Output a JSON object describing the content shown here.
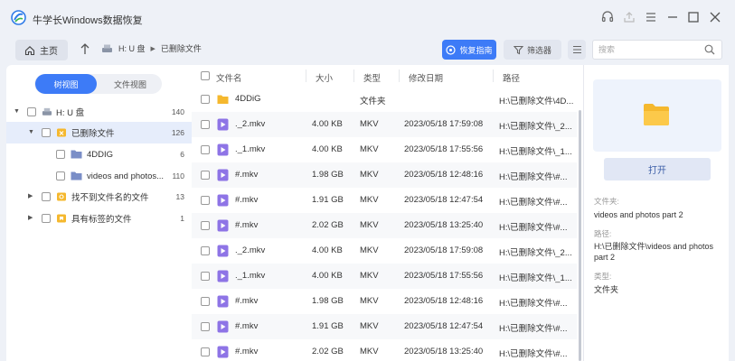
{
  "app": {
    "title": "牛学长Windows数据恢复"
  },
  "toolbar": {
    "home_label": "主页",
    "path": {
      "drive": "H: U 盘",
      "folder": "已删除文件"
    },
    "guide_label": "恢复指南",
    "filter_label": "筛选器",
    "search_placeholder": "搜索"
  },
  "left": {
    "tabs": {
      "tree": "树视图",
      "file": "文件视图"
    },
    "tree": [
      {
        "label": "H: U 盘",
        "count": "140"
      },
      {
        "label": "已删除文件",
        "count": "126"
      },
      {
        "label": "4DDIG",
        "count": "6"
      },
      {
        "label": "videos and photos...",
        "count": "110"
      },
      {
        "label": "找不到文件名的文件",
        "count": "13"
      },
      {
        "label": "具有标签的文件",
        "count": "1"
      }
    ]
  },
  "table": {
    "headers": {
      "name": "文件名",
      "size": "大小",
      "type": "类型",
      "date": "修改日期",
      "path": "路径"
    },
    "rows": [
      {
        "name": "4DDiG",
        "size": "",
        "type": "文件夹",
        "date": "",
        "path": "H:\\已删除文件\\4D..."
      },
      {
        "name": "._2.mkv",
        "size": "4.00 KB",
        "type": "MKV",
        "date": "2023/05/18 17:59:08",
        "path": "H:\\已删除文件\\_2..."
      },
      {
        "name": "._1.mkv",
        "size": "4.00 KB",
        "type": "MKV",
        "date": "2023/05/18 17:55:56",
        "path": "H:\\已删除文件\\_1..."
      },
      {
        "name": "#.mkv",
        "size": "1.98 GB",
        "type": "MKV",
        "date": "2023/05/18 12:48:16",
        "path": "H:\\已删除文件\\#..."
      },
      {
        "name": "#.mkv",
        "size": "1.91 GB",
        "type": "MKV",
        "date": "2023/05/18 12:47:54",
        "path": "H:\\已删除文件\\#..."
      },
      {
        "name": "#.mkv",
        "size": "2.02 GB",
        "type": "MKV",
        "date": "2023/05/18 13:25:40",
        "path": "H:\\已删除文件\\#..."
      },
      {
        "name": "._2.mkv",
        "size": "4.00 KB",
        "type": "MKV",
        "date": "2023/05/18 17:59:08",
        "path": "H:\\已删除文件\\_2..."
      },
      {
        "name": "._1.mkv",
        "size": "4.00 KB",
        "type": "MKV",
        "date": "2023/05/18 17:55:56",
        "path": "H:\\已删除文件\\_1..."
      },
      {
        "name": "#.mkv",
        "size": "1.98 GB",
        "type": "MKV",
        "date": "2023/05/18 12:48:16",
        "path": "H:\\已删除文件\\#..."
      },
      {
        "name": "#.mkv",
        "size": "1.91 GB",
        "type": "MKV",
        "date": "2023/05/18 12:47:54",
        "path": "H:\\已删除文件\\#..."
      },
      {
        "name": "#.mkv",
        "size": "2.02 GB",
        "type": "MKV",
        "date": "2023/05/18 13:25:40",
        "path": "H:\\已删除文件\\#..."
      }
    ]
  },
  "details": {
    "open_label": "打开",
    "folder_label": "文件夹:",
    "folder_value": "videos and photos part 2",
    "path_label": "路径:",
    "path_value": "H:\\已删除文件\\videos and photos part 2",
    "type_label": "类型:",
    "type_value": "文件夹"
  },
  "colors": {
    "accent": "#3d7bf7",
    "folder": "#f5b82e",
    "video": "#8e74e6"
  }
}
